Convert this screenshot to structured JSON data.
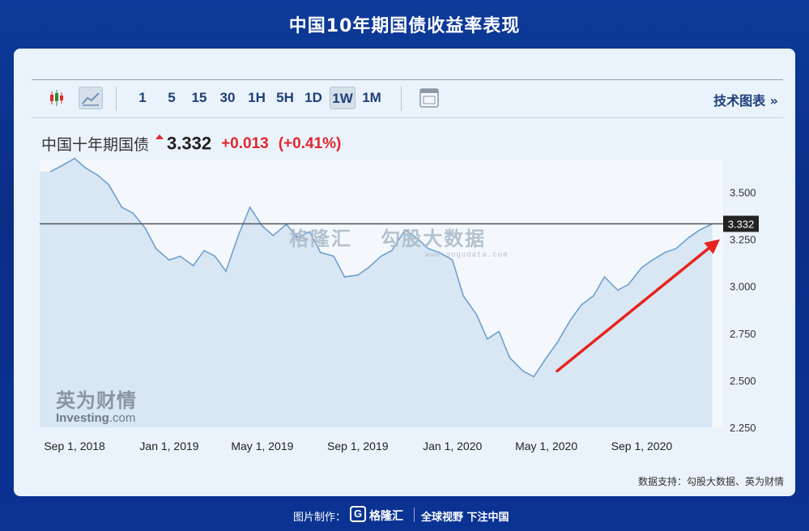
{
  "page": {
    "title": "中国10年期国债收益率表现",
    "source": "数据支持：勾股大数据、英为财情",
    "footer_label": "图片制作：",
    "footer_brand": "格隆汇",
    "footer_slogan": "全球视野 下注中国"
  },
  "toolbar": {
    "intervals": [
      "1",
      "5",
      "15",
      "30",
      "1H",
      "5H",
      "1D",
      "1W",
      "1M"
    ],
    "active_interval": "1W",
    "tech_link": "技术图表 »",
    "icons": [
      "candlestick-icon",
      "area-chart-icon",
      "calendar-icon"
    ]
  },
  "quote": {
    "name": "中国十年期国债",
    "price": "3.332",
    "change": "+0.013",
    "change_pct": "(+0.41%)",
    "up_color": "#e0282e"
  },
  "watermarks": {
    "investing_cn": "英为财情",
    "investing_en": "Investing",
    "investing_suffix": ".com",
    "center_brand_1": "格隆汇",
    "center_brand_2": "勾股大数据",
    "center_url": "www.gogudata.com"
  },
  "chart_data": {
    "type": "area",
    "x_tick_labels": [
      "Sep 1, 2018",
      "Jan 1, 2019",
      "May 1, 2019",
      "Sep 1, 2019",
      "Jan 1, 2020",
      "May 1, 2020",
      "Sep 1, 2020"
    ],
    "y_ticks": [
      2.25,
      2.5,
      2.75,
      3.0,
      3.25,
      3.5
    ],
    "y_tick_labels": [
      "2.250",
      "2.500",
      "2.750",
      "3.000",
      "3.250",
      "3.500"
    ],
    "ylim": [
      2.25,
      3.67
    ],
    "last_value_label": "3.332",
    "last_value": 3.332,
    "x": [
      "2018-08-01",
      "2018-08-15",
      "2018-09-01",
      "2018-09-15",
      "2018-10-01",
      "2018-10-15",
      "2018-11-01",
      "2018-11-15",
      "2018-12-01",
      "2018-12-15",
      "2019-01-01",
      "2019-01-15",
      "2019-02-01",
      "2019-02-15",
      "2019-03-01",
      "2019-03-15",
      "2019-04-01",
      "2019-04-15",
      "2019-05-01",
      "2019-05-15",
      "2019-06-01",
      "2019-06-15",
      "2019-07-01",
      "2019-07-15",
      "2019-08-01",
      "2019-08-15",
      "2019-09-01",
      "2019-09-15",
      "2019-10-01",
      "2019-10-15",
      "2019-11-01",
      "2019-11-15",
      "2019-12-01",
      "2019-12-15",
      "2020-01-01",
      "2020-01-15",
      "2020-02-01",
      "2020-02-15",
      "2020-03-01",
      "2020-03-15",
      "2020-04-01",
      "2020-04-15",
      "2020-05-01",
      "2020-05-15",
      "2020-06-01",
      "2020-06-15",
      "2020-07-01",
      "2020-07-15",
      "2020-08-01",
      "2020-08-15",
      "2020-09-01",
      "2020-09-15",
      "2020-10-01",
      "2020-10-15",
      "2020-11-01",
      "2020-11-15",
      "2020-12-01"
    ],
    "values": [
      3.61,
      3.64,
      3.68,
      3.63,
      3.59,
      3.54,
      3.42,
      3.39,
      3.31,
      3.2,
      3.14,
      3.16,
      3.11,
      3.19,
      3.16,
      3.08,
      3.28,
      3.42,
      3.32,
      3.27,
      3.33,
      3.26,
      3.29,
      3.18,
      3.16,
      3.05,
      3.06,
      3.1,
      3.16,
      3.19,
      3.3,
      3.26,
      3.2,
      3.18,
      3.14,
      2.95,
      2.85,
      2.72,
      2.76,
      2.62,
      2.55,
      2.52,
      2.62,
      2.7,
      2.82,
      2.9,
      2.95,
      3.05,
      2.98,
      3.01,
      3.1,
      3.14,
      3.18,
      3.2,
      3.26,
      3.3,
      3.332
    ],
    "series": [
      {
        "values_ref": "values"
      }
    ],
    "colors": {
      "line": "#6f9fd0",
      "fill": "#d2e4f1",
      "hline": "#555555",
      "arrow": "#e8231f"
    },
    "annotation": "red arrow pointing to latest value",
    "grid": false,
    "legend": "none"
  }
}
